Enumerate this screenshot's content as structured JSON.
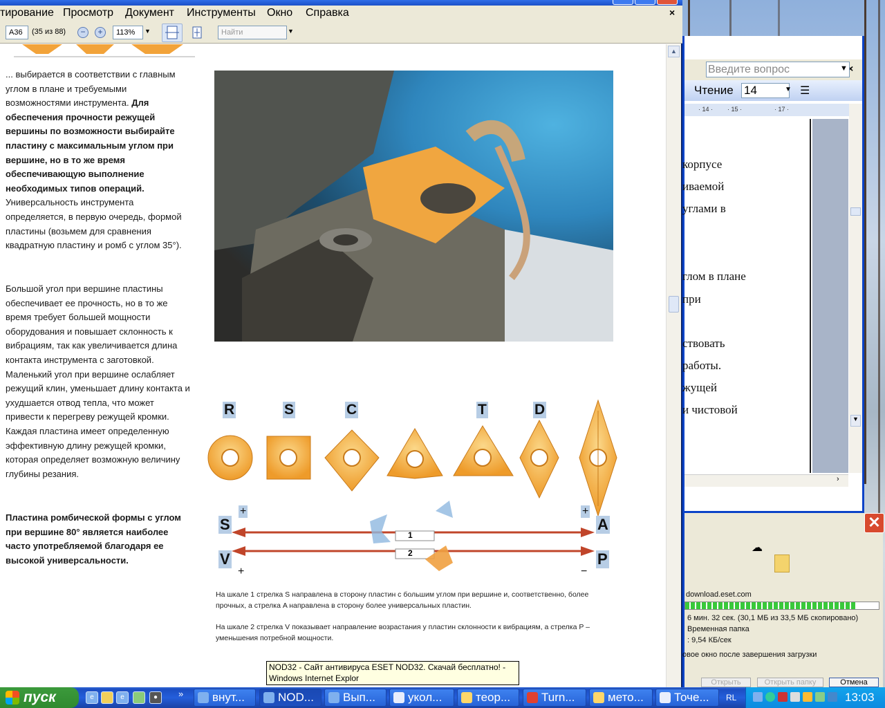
{
  "reader": {
    "menu": [
      "тирование",
      "Просмотр",
      "Документ",
      "Инструменты",
      "Окно",
      "Справка"
    ],
    "close_glyph": "×",
    "toolbar": {
      "page_label": "A36",
      "page_count": "(35 из 88)",
      "zoom": "113%",
      "find_placeholder": "Найти",
      "zoom_out_glyph": "−",
      "zoom_in_glyph": "+"
    },
    "left_column": {
      "para1_normal": "... выбирается в соответствии с главным углом в плане и требуемыми возможностями инструмента.",
      "para1_bold": "Для обеспечения прочности режущей вершины по возможности выбирайте пластину с максимальным углом при вершине, но в то же время обеспечивающую выполнение необходимых типов операций.",
      "para1_tail": "Универсальность инструмента определяется, в первую очередь, формой пластины (возьмем для сравнения квадратную пластину и ромб с углом 35°).",
      "para2": "Большой угол при вершине пластины обеспечивает ее прочность, но в то же время требует большей мощности оборудования и повышает склонность к вибрациям, так как увеличивается длина контакта инструмента с заготовкой. Маленький угол при вершине ослабляет режущий клин, уменьшает длину контакта и ухудшается отвод тепла, что может привести к перегреву режущей кромки. Каждая пластина имеет определенную эффективную длину режущей кромки, которая определяет возможную величину глубины резания.",
      "para3_bold": "Пластина ромбической формы с углом при вершине 80° является наиболее часто употребляемой благодаря ее высокой универсальности."
    },
    "diagram": {
      "shape_letters": [
        "R",
        "S",
        "C",
        "T",
        "D"
      ],
      "axis_left_top": "S",
      "axis_left_bottom": "V",
      "axis_right_top": "A",
      "axis_right_bottom": "P",
      "scale1": "1",
      "scale2": "2",
      "plus_tl": "+",
      "plus_tr": "+",
      "plus_bl": "+",
      "minus_br": "−"
    },
    "caption1": "На шкале 1 стрелка S направлена в сторону пластин с большим углом при вершине и, соответственно, более прочных, а стрелка A направлена в сторону более универсальных пластин.",
    "caption2": "На шкале 2 стрелка V показывает направление возрастания у пластин склонности к вибрациям, а стрелка P – уменьшения потребной мощности."
  },
  "word": {
    "help_placeholder": "Введите вопрос",
    "style_name": "Чтение",
    "font_size": "14",
    "ruler_marks": [
      "· 14 ·",
      "· 15 ·",
      "· 17 ·"
    ],
    "lines": [
      "корпусе",
      "иваемой",
      "углами в",
      "глом в плане",
      "при",
      "ствовать",
      "работы.",
      "жущей",
      "и чистовой"
    ]
  },
  "download": {
    "source": "download.eset.com",
    "progress_fraction": 0.88,
    "time_left": "6 мин. 32 сек. (30,1 МБ из 33,5 МБ скопировано)",
    "folder": "Временная папка",
    "speed": ": 9,54 КБ/сек",
    "checkbox_label": "овое окно после завершения загрузки",
    "btn_open": "Открыть",
    "btn_open_folder": "Открыть папку",
    "btn_cancel": "Отмена"
  },
  "tooltip": {
    "line1": "NOD32 - Сайт антивируса ESET NOD32. Скачай бесплатно! -",
    "line2": "Windows Internet Explor"
  },
  "taskbar": {
    "start_label": "пуск",
    "tasks": [
      "внут...",
      "NOD...",
      "Вып...",
      "укол...",
      "теор...",
      "Turn...",
      "мето...",
      "Точе..."
    ],
    "language": "RL",
    "clock": "13:03"
  }
}
